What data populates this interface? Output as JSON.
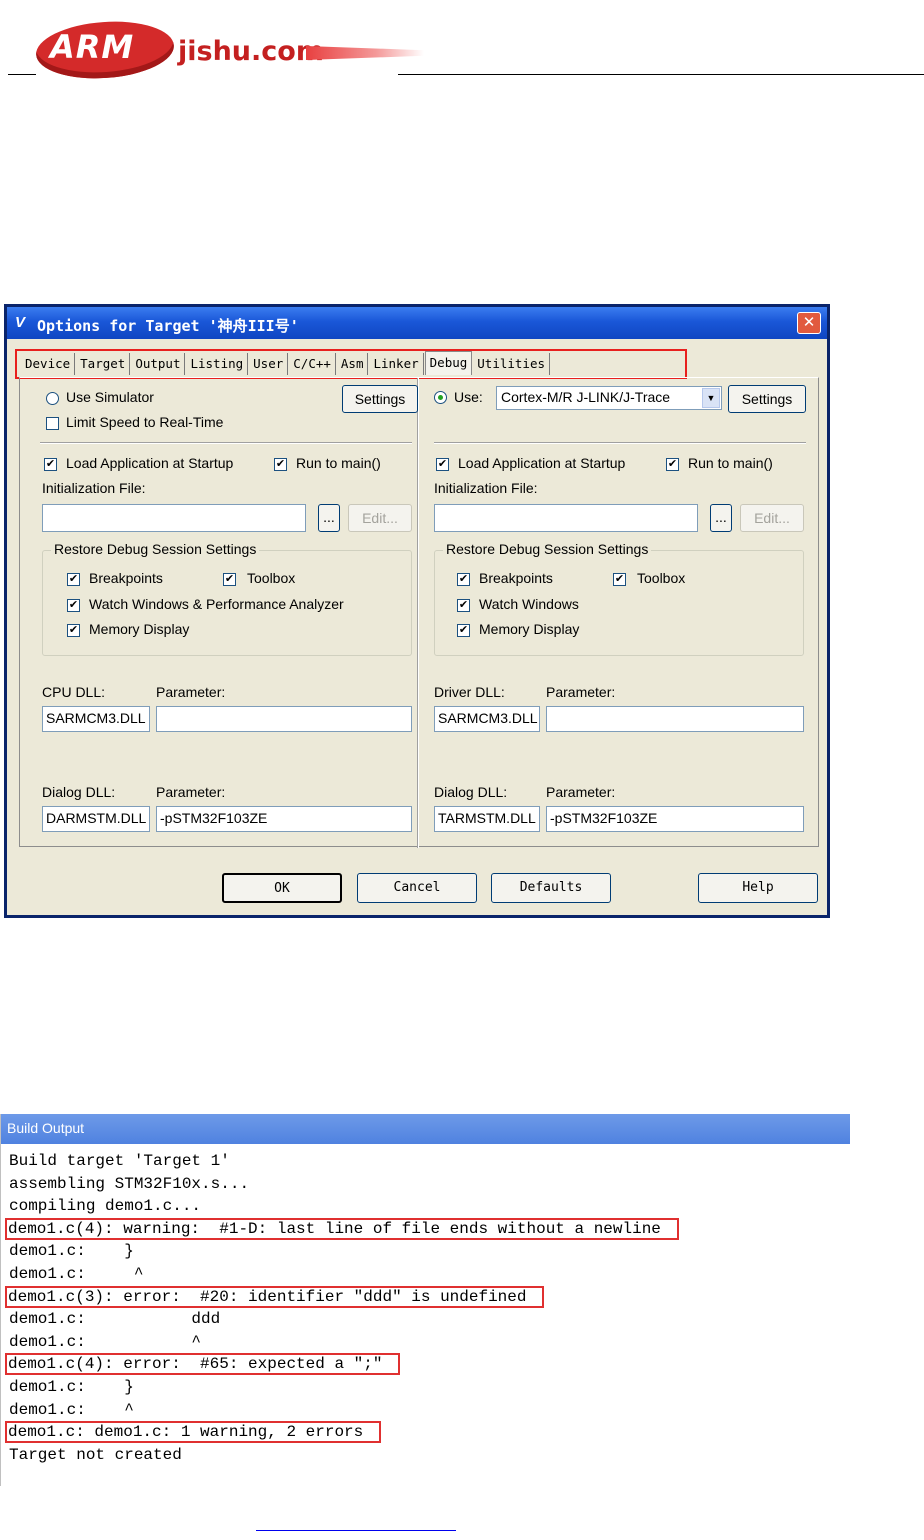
{
  "logo": {
    "arm": "ARM",
    "rest": "jishu.com"
  },
  "dialog": {
    "title": "Options for Target '神舟III号'",
    "title_icon": "V",
    "close_label": "✕",
    "tabs": [
      "Device",
      "Target",
      "Output",
      "Listing",
      "User",
      "C/C++",
      "Asm",
      "Linker",
      "Debug",
      "Utilities"
    ],
    "active_tab": "Debug",
    "left": {
      "use_simulator": "Use Simulator",
      "settings": "Settings",
      "limit_speed": "Limit Speed to Real-Time",
      "load_app": "Load Application at Startup",
      "run_to_main": "Run to main()",
      "init_file": "Initialization File:",
      "browse": "...",
      "edit": "Edit...",
      "restore_title": "Restore Debug Session Settings",
      "breakpoints": "Breakpoints",
      "toolbox": "Toolbox",
      "watch": "Watch Windows & Performance Analyzer",
      "memory": "Memory Display",
      "cpu_dll_label": "CPU DLL:",
      "param_label": "Parameter:",
      "cpu_dll_value": "SARMCM3.DLL",
      "cpu_param_value": "",
      "dialog_dll_label": "Dialog DLL:",
      "dialog_param_label": "Parameter:",
      "dialog_dll_value": "DARMSTM.DLL",
      "dialog_param_value": "-pSTM32F103ZE"
    },
    "right": {
      "use_label": "Use:",
      "driver_select": "Cortex-M/R J-LINK/J-Trace",
      "settings": "Settings",
      "load_app": "Load Application at Startup",
      "run_to_main": "Run to main()",
      "init_file": "Initialization File:",
      "browse": "...",
      "edit": "Edit...",
      "restore_title": "Restore Debug Session Settings",
      "breakpoints": "Breakpoints",
      "toolbox": "Toolbox",
      "watch": "Watch Windows",
      "memory": "Memory Display",
      "driver_dll_label": "Driver DLL:",
      "param_label": "Parameter:",
      "driver_dll_value": "SARMCM3.DLL",
      "driver_param_value": "",
      "dialog_dll_label": "Dialog DLL:",
      "dialog_param_label": "Parameter:",
      "dialog_dll_value": "TARMSTM.DLL",
      "dialog_param_value": "-pSTM32F103ZE"
    },
    "footer": {
      "ok": "OK",
      "cancel": "Cancel",
      "defaults": "Defaults",
      "help": "Help"
    },
    "check_mark": "✔"
  },
  "build_output": {
    "title": "Build Output",
    "lines": [
      {
        "text": "Build target 'Target 1'",
        "highlight": false
      },
      {
        "text": "assembling STM32F10x.s...",
        "highlight": false
      },
      {
        "text": "compiling demo1.c...",
        "highlight": false
      },
      {
        "text": "demo1.c(4): warning:  #1-D: last line of file ends without a newline",
        "highlight": true
      },
      {
        "text": "demo1.c:    }",
        "highlight": false
      },
      {
        "text": "demo1.c:     ^",
        "highlight": false
      },
      {
        "text": "demo1.c(3): error:  #20: identifier \"ddd\" is undefined",
        "highlight": true
      },
      {
        "text": "demo1.c:           ddd",
        "highlight": false
      },
      {
        "text": "demo1.c:           ^",
        "highlight": false
      },
      {
        "text": "demo1.c(4): error:  #65: expected a \";\"",
        "highlight": true
      },
      {
        "text": "demo1.c:    }",
        "highlight": false
      },
      {
        "text": "demo1.c:    ^",
        "highlight": false
      },
      {
        "text": "demo1.c: demo1.c: 1 warning, 2 errors",
        "highlight": true
      },
      {
        "text": "Target not created",
        "highlight": false
      }
    ]
  }
}
